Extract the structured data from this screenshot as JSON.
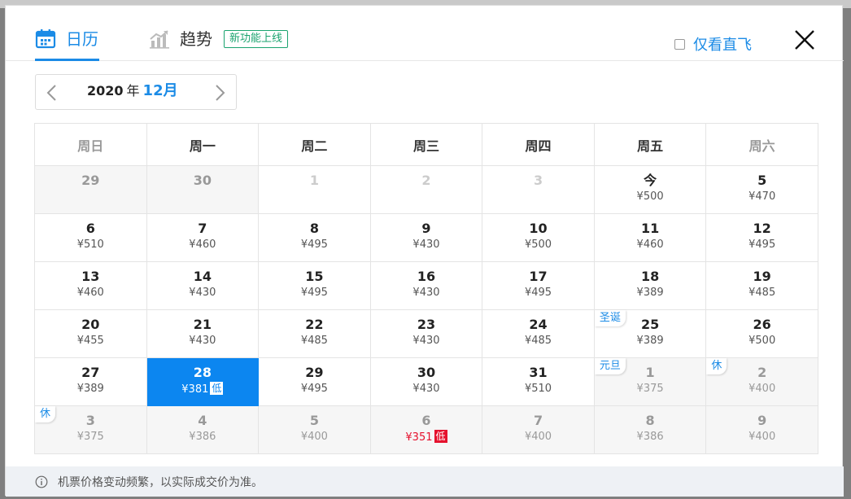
{
  "tabs": [
    {
      "label": "日历",
      "icon": "calendar-icon",
      "active": true
    },
    {
      "label": "趋势",
      "icon": "trend-chart-icon",
      "active": false,
      "badge": "新功能上线"
    }
  ],
  "direct_filter": {
    "label": "仅看直飞",
    "checked": false
  },
  "month_nav": {
    "year": "2020",
    "year_suffix": "年",
    "month": "12月"
  },
  "weekdays": [
    "周日",
    "周一",
    "周二",
    "周三",
    "周四",
    "周五",
    "周六"
  ],
  "weeks": [
    [
      {
        "day": "29",
        "price": "",
        "state": "past prev-month other"
      },
      {
        "day": "30",
        "price": "",
        "state": "past prev-month other"
      },
      {
        "day": "1",
        "price": "",
        "state": "past"
      },
      {
        "day": "2",
        "price": "",
        "state": "past"
      },
      {
        "day": "3",
        "price": "",
        "state": "past"
      },
      {
        "day": "今",
        "price": "¥500",
        "state": ""
      },
      {
        "day": "5",
        "price": "¥470",
        "state": ""
      }
    ],
    [
      {
        "day": "6",
        "price": "¥510",
        "state": ""
      },
      {
        "day": "7",
        "price": "¥460",
        "state": ""
      },
      {
        "day": "8",
        "price": "¥495",
        "state": ""
      },
      {
        "day": "9",
        "price": "¥430",
        "state": ""
      },
      {
        "day": "10",
        "price": "¥500",
        "state": ""
      },
      {
        "day": "11",
        "price": "¥460",
        "state": ""
      },
      {
        "day": "12",
        "price": "¥495",
        "state": ""
      }
    ],
    [
      {
        "day": "13",
        "price": "¥460",
        "state": ""
      },
      {
        "day": "14",
        "price": "¥430",
        "state": ""
      },
      {
        "day": "15",
        "price": "¥495",
        "state": ""
      },
      {
        "day": "16",
        "price": "¥430",
        "state": ""
      },
      {
        "day": "17",
        "price": "¥495",
        "state": ""
      },
      {
        "day": "18",
        "price": "¥389",
        "state": ""
      },
      {
        "day": "19",
        "price": "¥485",
        "state": ""
      }
    ],
    [
      {
        "day": "20",
        "price": "¥455",
        "state": ""
      },
      {
        "day": "21",
        "price": "¥430",
        "state": ""
      },
      {
        "day": "22",
        "price": "¥485",
        "state": ""
      },
      {
        "day": "23",
        "price": "¥430",
        "state": ""
      },
      {
        "day": "24",
        "price": "¥485",
        "state": ""
      },
      {
        "day": "25",
        "price": "¥389",
        "state": "",
        "holiday": "圣诞"
      },
      {
        "day": "26",
        "price": "¥500",
        "state": ""
      }
    ],
    [
      {
        "day": "27",
        "price": "¥389",
        "state": ""
      },
      {
        "day": "28",
        "price": "¥381",
        "state": "selected",
        "low": "低"
      },
      {
        "day": "29",
        "price": "¥495",
        "state": ""
      },
      {
        "day": "30",
        "price": "¥430",
        "state": ""
      },
      {
        "day": "31",
        "price": "¥510",
        "state": ""
      },
      {
        "day": "1",
        "price": "¥375",
        "state": "other",
        "holiday": "元旦"
      },
      {
        "day": "2",
        "price": "¥400",
        "state": "other",
        "holiday": "休"
      }
    ],
    [
      {
        "day": "3",
        "price": "¥375",
        "state": "other",
        "holiday": "休"
      },
      {
        "day": "4",
        "price": "¥386",
        "state": "other"
      },
      {
        "day": "5",
        "price": "¥400",
        "state": "other"
      },
      {
        "day": "6",
        "price": "¥351",
        "state": "other red-price",
        "low": "低"
      },
      {
        "day": "7",
        "price": "¥400",
        "state": "other"
      },
      {
        "day": "8",
        "price": "¥386",
        "state": "other"
      },
      {
        "day": "9",
        "price": "¥400",
        "state": "other"
      }
    ]
  ],
  "footer": {
    "notice": "机票价格变动频繁，以实际成交价为准。"
  },
  "colors": {
    "accent": "#1b8be6",
    "selected": "#0c86f0",
    "low_price": "#e5112d",
    "badge": "#1aa36f"
  }
}
